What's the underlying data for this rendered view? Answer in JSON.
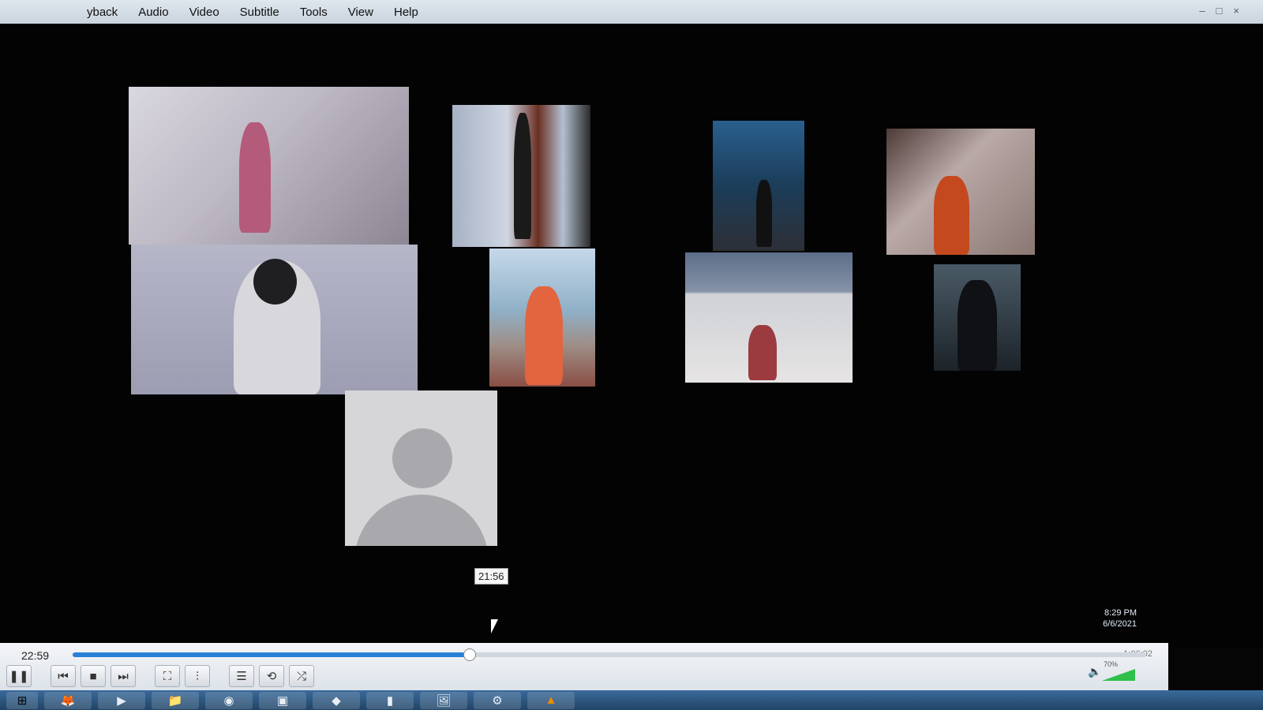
{
  "menu": {
    "items": [
      "yback",
      "Audio",
      "Video",
      "Subtitle",
      "Tools",
      "View",
      "Help"
    ]
  },
  "window_controls": [
    "–",
    "□",
    "×"
  ],
  "participants": [
    {
      "id": "p1",
      "kind": "video"
    },
    {
      "id": "p2",
      "kind": "video"
    },
    {
      "id": "p3",
      "kind": "video"
    },
    {
      "id": "p4",
      "kind": "video"
    },
    {
      "id": "p5",
      "kind": "video"
    },
    {
      "id": "p6",
      "kind": "video"
    },
    {
      "id": "p7",
      "kind": "video"
    },
    {
      "id": "p8",
      "kind": "video"
    },
    {
      "id": "p9",
      "kind": "placeholder-avatar"
    }
  ],
  "player": {
    "elapsed": "22:59",
    "total": "1:06:02",
    "hover_time": "21:56",
    "progress_fraction": 0.37,
    "volume_label": "70%",
    "volume_fraction": 0.7,
    "buttons": [
      {
        "name": "pause-button",
        "glyph": "❚❚"
      },
      {
        "name": "previous-button",
        "glyph": "⏮"
      },
      {
        "name": "stop-button",
        "glyph": "■"
      },
      {
        "name": "next-button",
        "glyph": "⏭"
      },
      {
        "name": "fullscreen-button",
        "glyph": "⛶"
      },
      {
        "name": "extended-settings-button",
        "glyph": "⫶"
      },
      {
        "name": "playlist-button",
        "glyph": "☰"
      },
      {
        "name": "loop-button",
        "glyph": "⟲"
      },
      {
        "name": "shuffle-button",
        "glyph": "⤮"
      }
    ]
  },
  "taskbar": {
    "icons": [
      "firefox-icon",
      "media-player-icon",
      "file-explorer-icon",
      "chrome-icon",
      "window-icon",
      "windows-media-center-icon",
      "app-icon",
      "photos-icon",
      "settings-icon",
      "vlc-icon"
    ],
    "clock_time": "8:29 PM",
    "clock_date": "6/6/2021"
  }
}
